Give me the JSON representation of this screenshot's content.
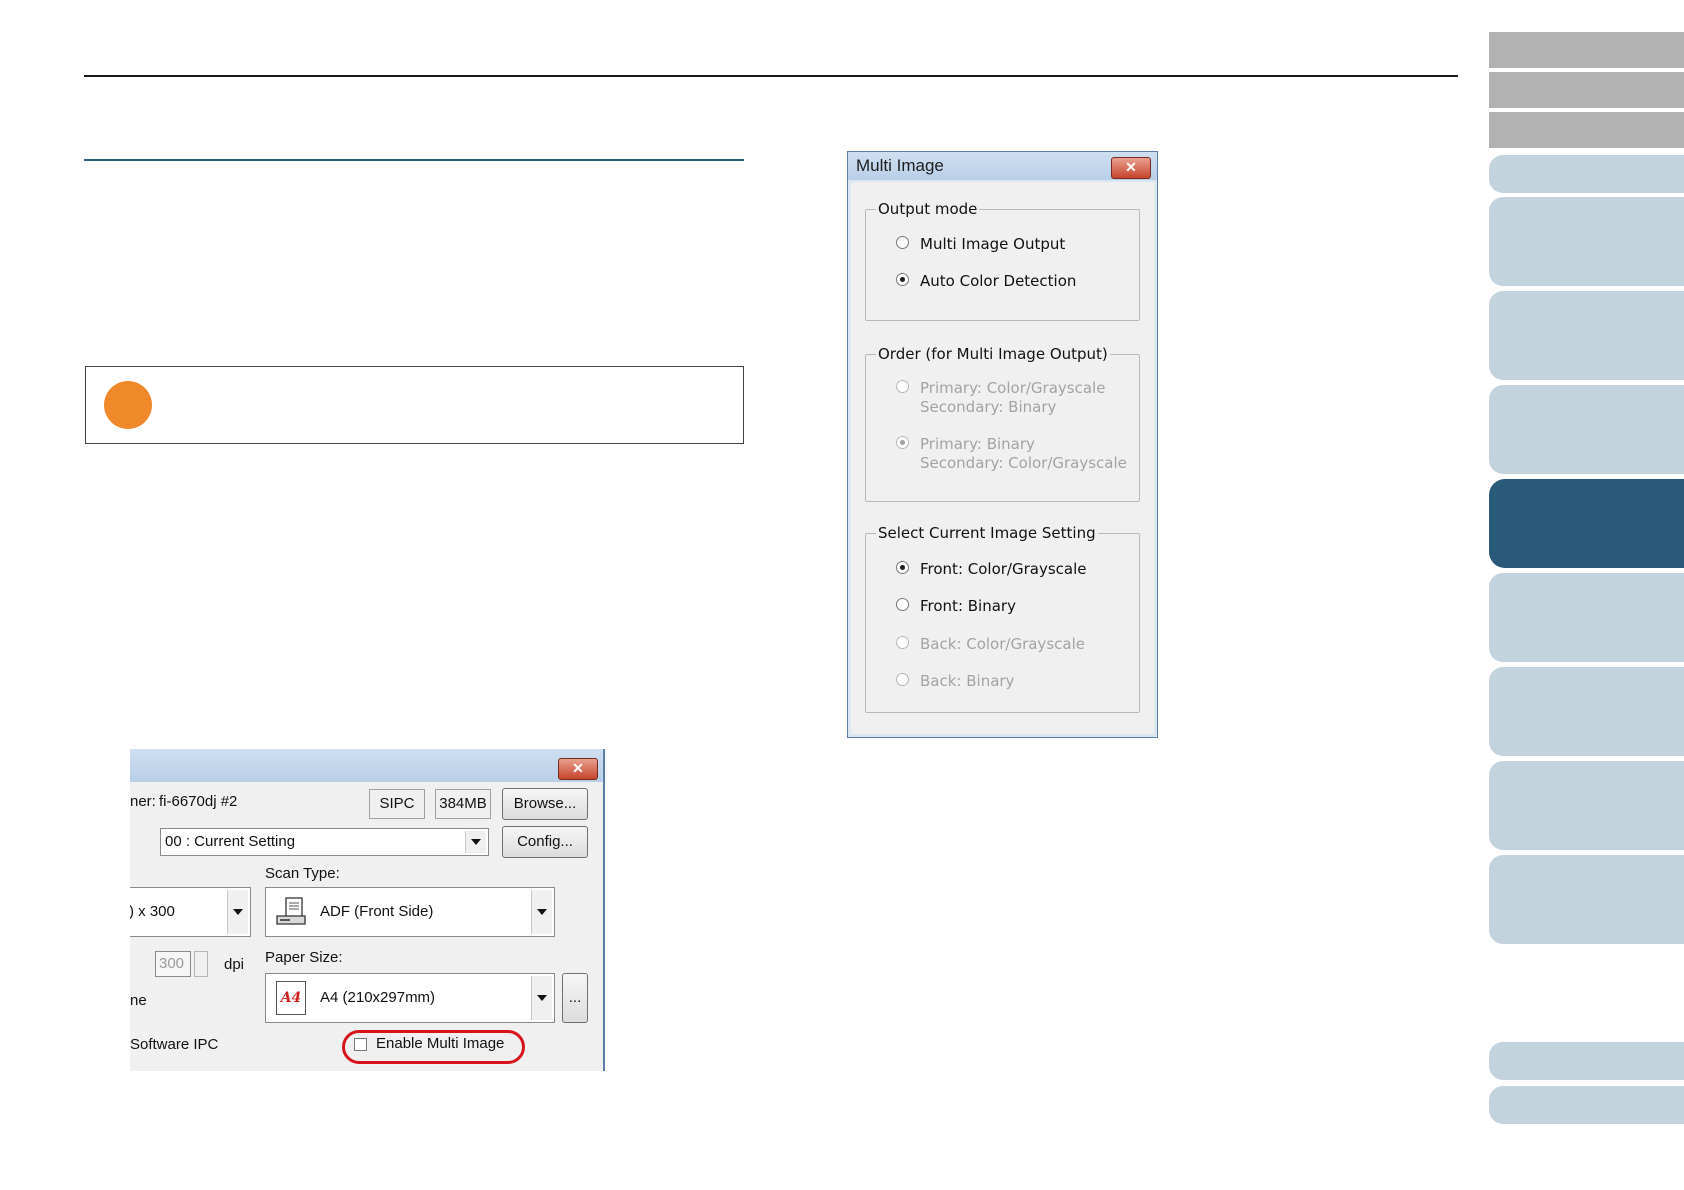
{
  "multi_image_dialog": {
    "title": "Multi Image",
    "close_glyph": "✕",
    "output_mode": {
      "label": "Output mode",
      "options": [
        {
          "label": "Multi Image Output",
          "checked": false,
          "enabled": true
        },
        {
          "label": "Auto Color Detection",
          "checked": true,
          "enabled": true
        }
      ]
    },
    "order": {
      "label": "Order (for Multi Image Output)",
      "options": [
        {
          "line1": "Primary: Color/Grayscale",
          "line2": "Secondary: Binary",
          "checked": false,
          "enabled": false
        },
        {
          "line1": "Primary: Binary",
          "line2": "Secondary: Color/Grayscale",
          "checked": true,
          "enabled": false
        }
      ]
    },
    "select_current": {
      "label": "Select Current Image Setting",
      "options": [
        {
          "label": "Front: Color/Grayscale",
          "checked": true,
          "enabled": true
        },
        {
          "label": "Front: Binary",
          "checked": false,
          "enabled": true
        },
        {
          "label": "Back: Color/Grayscale",
          "checked": false,
          "enabled": false
        },
        {
          "label": "Back: Binary",
          "checked": false,
          "enabled": false
        }
      ]
    }
  },
  "scanner_dialog": {
    "close_glyph": "✕",
    "scanner_label": "ner:",
    "scanner_name": "fi-6670dj #2",
    "sipc": "SIPC",
    "memory": "384MB",
    "browse_button": "Browse...",
    "setting_value": "00 : Current Setting",
    "config_button": "Config...",
    "scan_type_label": "Scan Type:",
    "resolution_value": ") x 300",
    "scan_type_value": "ADF (Front Side)",
    "custom_dpi_value": "300",
    "dpi_label": "dpi",
    "paper_size_label": "Paper Size:",
    "paper_size_value": "A4 (210x297mm)",
    "paper_icon_text": "A4",
    "partial_label": "ne",
    "more_button": "...",
    "software_ipc_label": "Software IPC",
    "enable_multi_image_label": "Enable Multi Image",
    "enable_multi_image_checked": false
  },
  "colors": {
    "note_dot": "#f0892a",
    "highlight_oval": "#d7121b",
    "tab_dark": "#2a5a7a",
    "tab_light": "#c3d3de",
    "tab_gray": "#b2b2b2"
  }
}
